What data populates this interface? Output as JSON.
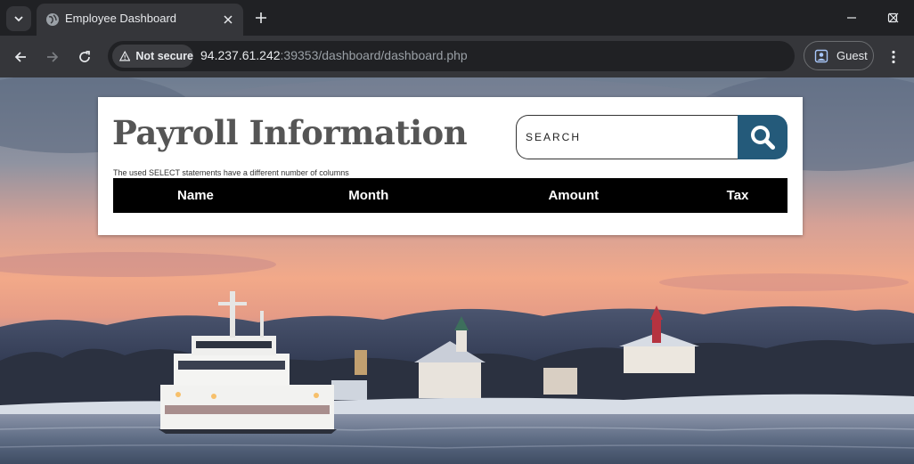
{
  "browser": {
    "tab": {
      "title": "Employee Dashboard"
    },
    "security_label": "Not secure",
    "url": {
      "host": "94.237.61.242",
      "rest": ":39353/dashboard/dashboard.php"
    },
    "profile_label": "Guest"
  },
  "page": {
    "title": "Payroll Information",
    "search": {
      "placeholder": "SEARCH",
      "value": ""
    },
    "error_message": "The used SELECT statements have a different number of columns",
    "table": {
      "headers": [
        "Name",
        "Month",
        "Amount",
        "Tax"
      ]
    }
  },
  "colors": {
    "search_button": "#245a7a",
    "table_header_bg": "#000000",
    "browser_frame": "#202124",
    "toolbar": "#35363a"
  },
  "icons": {
    "tab_search": "chevron-down-icon",
    "favicon": "globe-icon",
    "tab_close": "close-icon",
    "new_tab": "plus-icon",
    "back": "arrow-left-icon",
    "forward": "arrow-right-icon",
    "reload": "reload-icon",
    "warning": "warning-icon",
    "profile": "profile-icon",
    "menu": "kebab-menu-icon",
    "search": "search-icon"
  }
}
